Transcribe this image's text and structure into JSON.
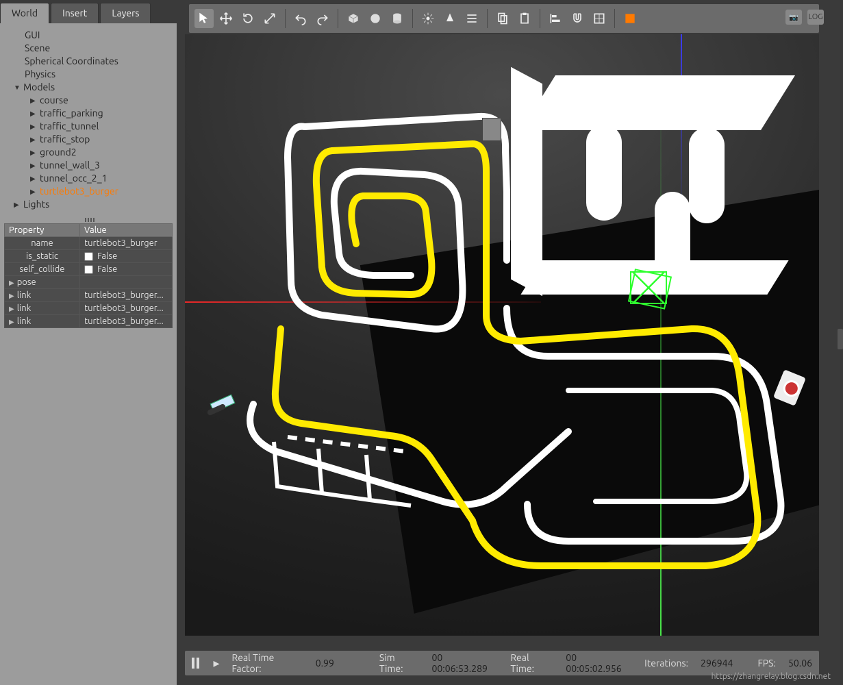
{
  "tabs": {
    "world": "World",
    "insert": "Insert",
    "layers": "Layers"
  },
  "tree": {
    "gui": "GUI",
    "scene": "Scene",
    "sphcoord": "Spherical Coordinates",
    "physics": "Physics",
    "models": "Models",
    "model_items": [
      "course",
      "traffic_parking",
      "traffic_tunnel",
      "traffic_stop",
      "ground2",
      "tunnel_wall_3",
      "tunnel_occ_2_1",
      "turtlebot3_burger"
    ],
    "lights": "Lights"
  },
  "prop": {
    "hdr_prop": "Property",
    "hdr_val": "Value",
    "rows": [
      {
        "k": "name",
        "v": "turtlebot3_burger",
        "type": "text"
      },
      {
        "k": "is_static",
        "v": "False",
        "type": "check"
      },
      {
        "k": "self_collide",
        "v": "False",
        "type": "check"
      },
      {
        "k": "pose",
        "v": "",
        "type": "tri"
      },
      {
        "k": "link",
        "v": "turtlebot3_burger...",
        "type": "tri"
      },
      {
        "k": "link",
        "v": "turtlebot3_burger...",
        "type": "tri"
      },
      {
        "k": "link",
        "v": "turtlebot3_burger...",
        "type": "tri"
      }
    ]
  },
  "toolbar": {
    "select": "select-arrow-icon",
    "translate": "move-icon",
    "rotate": "rotate-icon",
    "scale": "scale-icon",
    "undo": "undo-icon",
    "redo": "redo-icon",
    "box": "cube-icon",
    "sphere": "sphere-icon",
    "cylinder": "cylinder-icon",
    "pointlight": "point-light-icon",
    "spotlight": "spot-light-icon",
    "dirlight": "directional-light-icon",
    "copy": "copy-icon",
    "paste": "paste-icon",
    "align": "align-icon",
    "snap": "snap-icon",
    "capture": "screenshot-icon",
    "log": "log-icon",
    "record": "record-icon"
  },
  "status": {
    "rtf_label": "Real Time Factor:",
    "rtf_value": "0.99",
    "sim_label": "Sim Time:",
    "sim_value": "00 00:06:53.289",
    "real_label": "Real Time:",
    "real_value": "00 00:05:02.956",
    "iter_label": "Iterations:",
    "iter_value": "296944",
    "fps_label": "FPS:",
    "fps_value": "50.06"
  },
  "right_icons": {
    "camera": "📷",
    "log": "LOG"
  },
  "watermark": "https://zhangrelay.blog.csdn.net"
}
